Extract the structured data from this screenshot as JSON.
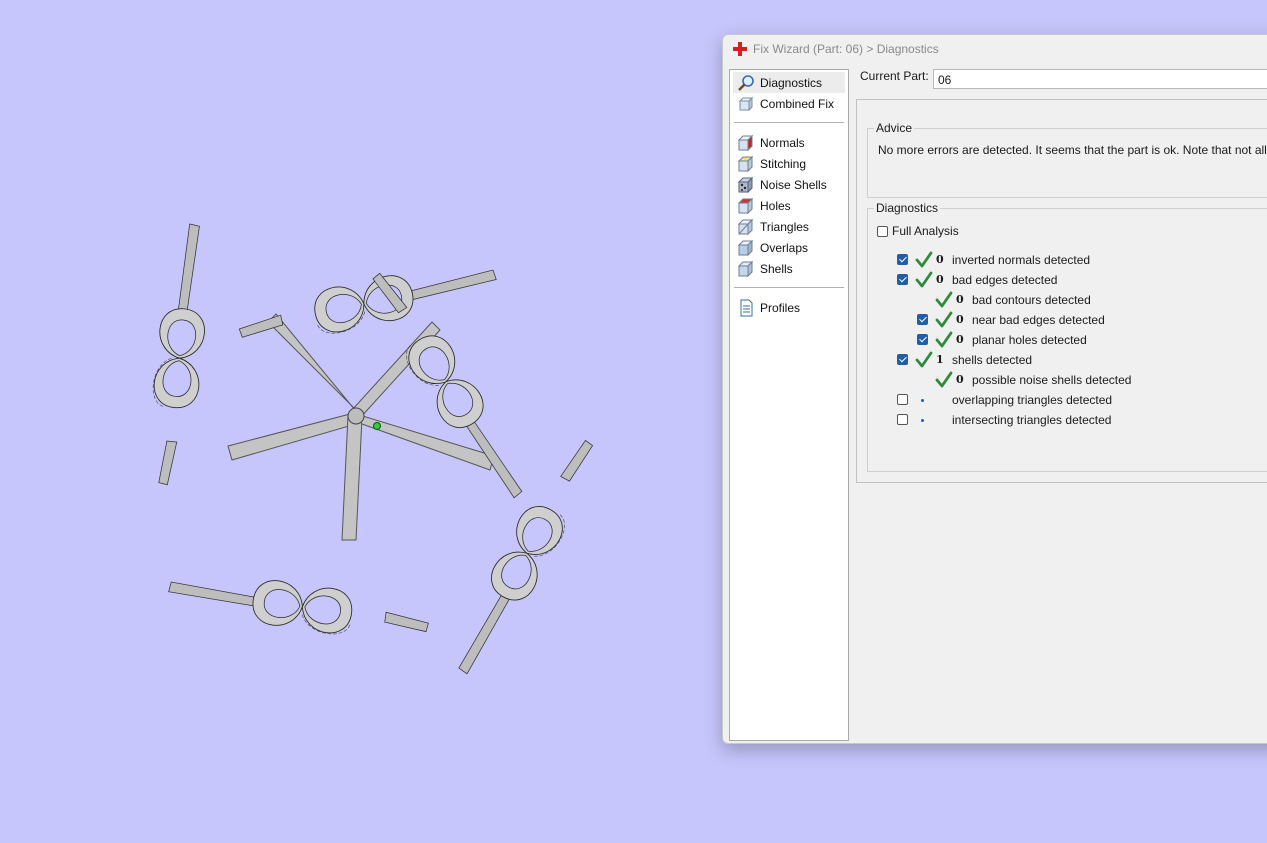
{
  "window": {
    "title": "Fix Wizard (Part: 06) > Diagnostics"
  },
  "nav": {
    "group1": [
      {
        "label": "Diagnostics",
        "icon": "magnifier-icon",
        "selected": true
      },
      {
        "label": "Combined Fix",
        "icon": "combined-fix-icon"
      }
    ],
    "group2": [
      {
        "label": "Normals",
        "icon": "normals-icon"
      },
      {
        "label": "Stitching",
        "icon": "stitching-icon"
      },
      {
        "label": "Noise Shells",
        "icon": "noise-shells-icon"
      },
      {
        "label": "Holes",
        "icon": "holes-icon"
      },
      {
        "label": "Triangles",
        "icon": "triangles-icon"
      },
      {
        "label": "Overlaps",
        "icon": "overlaps-icon"
      },
      {
        "label": "Shells",
        "icon": "shells-icon"
      }
    ],
    "group3": [
      {
        "label": "Profiles",
        "icon": "document-icon"
      }
    ]
  },
  "current_part": {
    "label": "Current Part:",
    "value": "06"
  },
  "advice": {
    "legend": "Advice",
    "text": "No more errors are detected. It seems that the part is ok. Note that not all param"
  },
  "diagnostics": {
    "legend": "Diagnostics",
    "full_analysis_label": "Full Analysis",
    "full_analysis_checked": false,
    "rows": [
      {
        "label": "inverted normals detected",
        "count": "0",
        "checkbox": true,
        "checked": true,
        "status": "ok",
        "level": 0
      },
      {
        "label": "bad edges detected",
        "count": "0",
        "checkbox": true,
        "checked": true,
        "status": "ok",
        "level": 0
      },
      {
        "label": "bad contours detected",
        "count": "0",
        "checkbox": false,
        "checked": false,
        "status": "ok",
        "level": 1
      },
      {
        "label": "near bad edges detected",
        "count": "0",
        "checkbox": true,
        "checked": true,
        "status": "ok",
        "level": 1
      },
      {
        "label": "planar holes detected",
        "count": "0",
        "checkbox": true,
        "checked": true,
        "status": "ok",
        "level": 1
      },
      {
        "label": "shells detected",
        "count": "1",
        "checkbox": true,
        "checked": true,
        "status": "ok",
        "level": 0
      },
      {
        "label": "possible noise shells detected",
        "count": "0",
        "checkbox": false,
        "checked": false,
        "status": "ok",
        "level": 1
      },
      {
        "label": "overlapping triangles detected",
        "count": "",
        "checkbox": true,
        "checked": false,
        "status": "pending",
        "level": 0
      },
      {
        "label": "intersecting triangles detected",
        "count": "",
        "checkbox": true,
        "checked": false,
        "status": "pending",
        "level": 0
      }
    ]
  },
  "colors": {
    "background": "#c6c6fc",
    "model": "#c8c8c8",
    "ok_check": "#2e8b3a",
    "checkbox_checked": "#1f5ea8",
    "title_icon": "#d42020"
  }
}
